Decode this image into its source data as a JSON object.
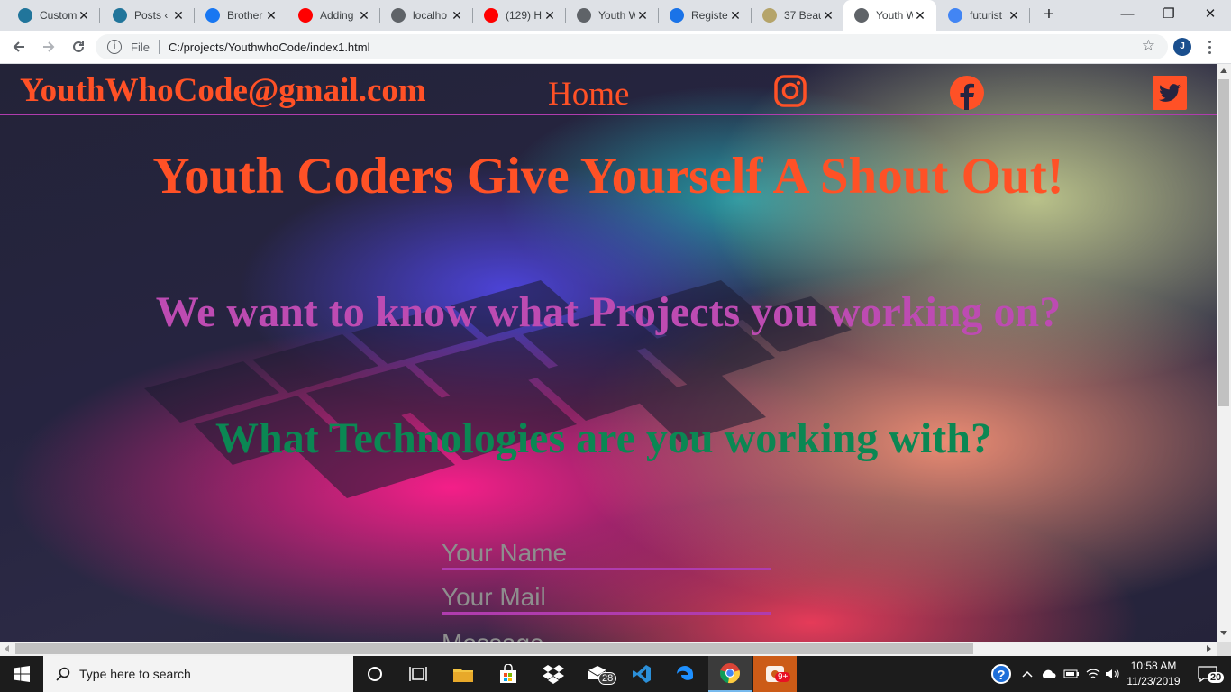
{
  "browser": {
    "tabs": [
      {
        "label": "Custom",
        "icon": "wordpress-icon",
        "color": "#21759b"
      },
      {
        "label": "Posts ‹",
        "icon": "wordpress-icon",
        "color": "#21759b"
      },
      {
        "label": "Brother",
        "icon": "facebook-icon",
        "color": "#1877f2"
      },
      {
        "label": "Adding",
        "icon": "youtube-icon",
        "color": "#ff0000"
      },
      {
        "label": "localho",
        "icon": "globe-icon",
        "color": "#5f6368"
      },
      {
        "label": "(129) H",
        "icon": "youtube-icon",
        "color": "#ff0000"
      },
      {
        "label": "Youth W",
        "icon": "globe-icon",
        "color": "#5f6368"
      },
      {
        "label": "Registe",
        "icon": "flag-icon",
        "color": "#1a73e8"
      },
      {
        "label": "37 Beau",
        "icon": "circle-icon",
        "color": "#b5a46a"
      },
      {
        "label": "Youth W",
        "icon": "globe-icon",
        "color": "#5f6368",
        "active": true
      },
      {
        "label": "futurist",
        "icon": "google-icon",
        "color": "#4285f4"
      }
    ],
    "new_tab": "+",
    "window": {
      "minimize": "—",
      "restore": "❐",
      "close": "✕"
    },
    "address": {
      "scheme": "File",
      "url": "C:/projects/YouthwhoCode/index1.html"
    },
    "profile_initial": "J"
  },
  "page": {
    "nav": {
      "email": "YouthWhoCode@gmail.com",
      "home": "Home",
      "accent": "#ff5126",
      "border": "#b03cae"
    },
    "hero_title": "Youth Coders Give Yourself A Shout Out!",
    "question1": "We want to know what Projects you working on?",
    "question2": "What Technologies are you working with?",
    "form": {
      "name_placeholder": "Your Name",
      "mail_placeholder": "Your Mail",
      "message_placeholder": "Message"
    }
  },
  "taskbar": {
    "search_placeholder": "Type here to search",
    "mail_badge": "28",
    "app_badge": "9+",
    "time": "10:58 AM",
    "date": "11/23/2019",
    "notifications": "20"
  }
}
